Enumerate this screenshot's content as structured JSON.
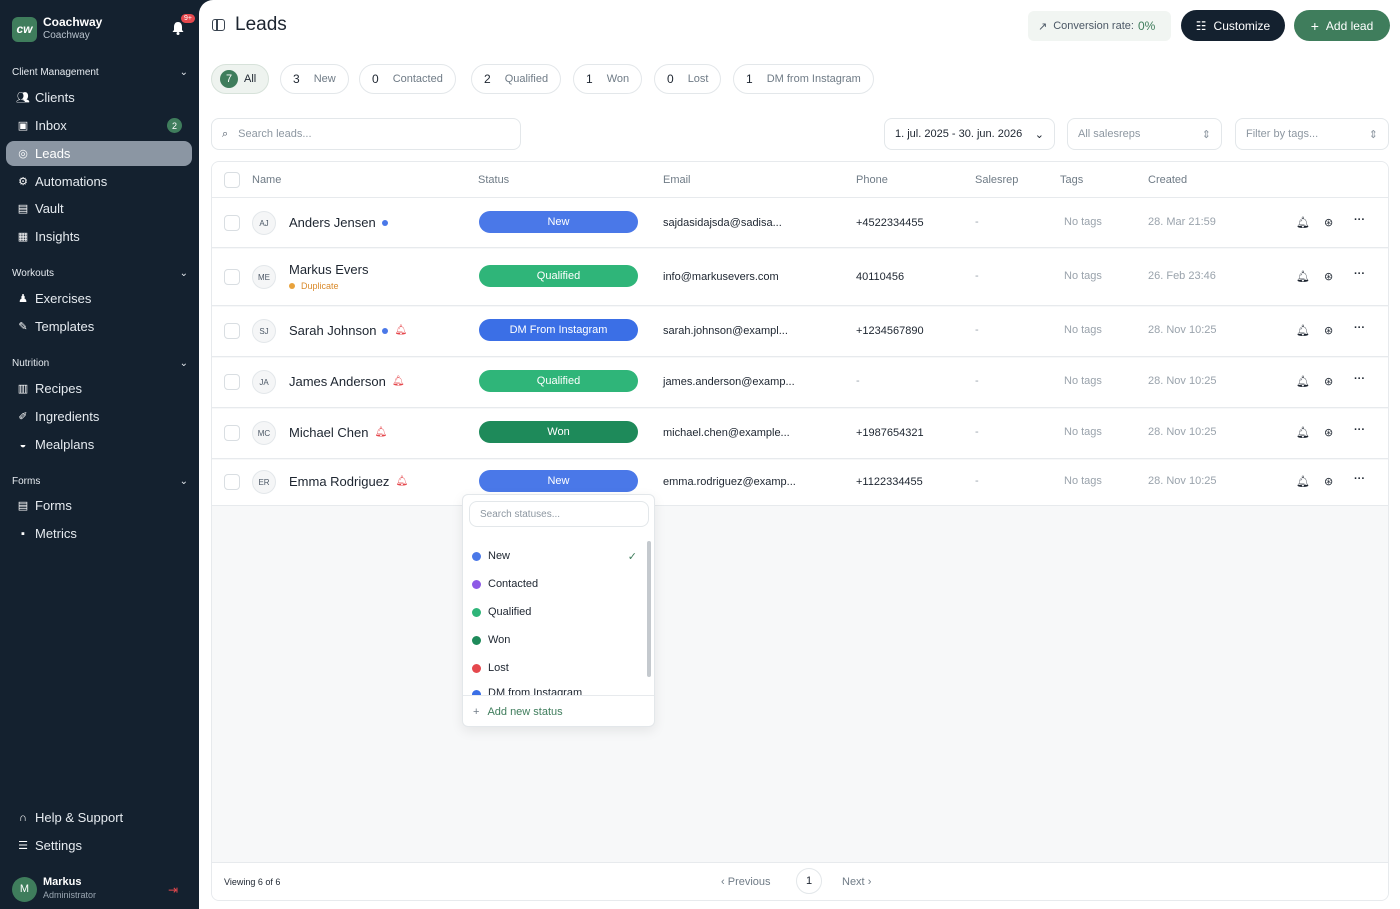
{
  "brand": {
    "name": "Coachway",
    "sub": "Coachway",
    "notif_badge": "9+"
  },
  "sidebar": {
    "sections": [
      {
        "label": "Client Management",
        "items": [
          {
            "label": "Clients",
            "icon": "users-icon"
          },
          {
            "label": "Inbox",
            "icon": "inbox-icon",
            "badge": "2"
          },
          {
            "label": "Leads",
            "icon": "target-icon",
            "active": true
          },
          {
            "label": "Automations",
            "icon": "robot-icon"
          },
          {
            "label": "Vault",
            "icon": "vault-icon"
          },
          {
            "label": "Insights",
            "icon": "chart-icon"
          }
        ]
      },
      {
        "label": "Workouts",
        "items": [
          {
            "label": "Exercises",
            "icon": "exercise-icon"
          },
          {
            "label": "Templates",
            "icon": "template-icon"
          }
        ]
      },
      {
        "label": "Nutrition",
        "items": [
          {
            "label": "Recipes",
            "icon": "recipe-icon"
          },
          {
            "label": "Ingredients",
            "icon": "carrot-icon"
          },
          {
            "label": "Mealplans",
            "icon": "meal-icon"
          }
        ]
      },
      {
        "label": "Forms",
        "items": [
          {
            "label": "Forms",
            "icon": "form-icon"
          },
          {
            "label": "Metrics",
            "icon": "metrics-icon"
          }
        ]
      }
    ],
    "help": "Help & Support",
    "settings": "Settings",
    "user": {
      "initial": "M",
      "name": "Markus",
      "role": "Administrator"
    }
  },
  "header": {
    "title": "Leads",
    "conversion_label": "Conversion rate:",
    "conversion_value": "0%",
    "customize": "Customize",
    "add_lead": "Add lead"
  },
  "tabs": [
    {
      "count": "7",
      "label": "All",
      "active": true
    },
    {
      "count": "3",
      "label": "New"
    },
    {
      "count": "0",
      "label": "Contacted"
    },
    {
      "count": "2",
      "label": "Qualified"
    },
    {
      "count": "1",
      "label": "Won"
    },
    {
      "count": "0",
      "label": "Lost"
    },
    {
      "count": "1",
      "label": "DM from Instagram"
    }
  ],
  "filters": {
    "search_placeholder": "Search leads...",
    "date_range": "1. jul. 2025 - 30. jun. 2026",
    "salesreps": "All salesreps",
    "tags": "Filter by tags..."
  },
  "table": {
    "columns": [
      "Name",
      "Status",
      "Email",
      "Phone",
      "Salesrep",
      "Tags",
      "Created"
    ],
    "rows": [
      {
        "initials": "AJ",
        "name": "Anders Jensen",
        "dot": true,
        "bell": false,
        "status": "New",
        "status_color": "#4a78e8",
        "email": "sajdasidajsda@sadisa...",
        "phone": "+4522334455",
        "salesrep": "-",
        "tags": "No tags",
        "created": "28. Mar 21:59"
      },
      {
        "initials": "ME",
        "name": "Markus Evers",
        "dot": false,
        "bell": false,
        "duplicate": "Duplicate",
        "status": "Qualified",
        "status_color": "#2fb579",
        "email": "info@markusevers.com",
        "phone": "40110456",
        "salesrep": "-",
        "tags": "No tags",
        "created": "26. Feb 23:46"
      },
      {
        "initials": "SJ",
        "name": "Sarah Johnson",
        "dot": true,
        "bell": true,
        "status": "DM From Instagram",
        "status_color": "#3b6fe6",
        "email": "sarah.johnson@exampl...",
        "phone": "+1234567890",
        "salesrep": "-",
        "tags": "No tags",
        "created": "28. Nov 10:25"
      },
      {
        "initials": "JA",
        "name": "James Anderson",
        "dot": false,
        "bell": true,
        "status": "Qualified",
        "status_color": "#2fb579",
        "email": "james.anderson@examp...",
        "phone": "-",
        "salesrep": "-",
        "tags": "No tags",
        "created": "28. Nov 10:25"
      },
      {
        "initials": "MC",
        "name": "Michael Chen",
        "dot": false,
        "bell": true,
        "status": "Won",
        "status_color": "#1e8a5a",
        "email": "michael.chen@example...",
        "phone": "+1987654321",
        "salesrep": "-",
        "tags": "No tags",
        "created": "28. Nov 10:25"
      },
      {
        "initials": "ER",
        "name": "Emma Rodriguez",
        "dot": false,
        "bell": true,
        "status": "New",
        "status_color": "#4a78e8",
        "email": "emma.rodriguez@examp...",
        "phone": "+1122334455",
        "salesrep": "-",
        "tags": "No tags",
        "created": "28. Nov 10:25"
      }
    ]
  },
  "pagination": {
    "viewing": "Viewing 6 of 6",
    "previous": "Previous",
    "page": "1",
    "next": "Next"
  },
  "status_dropdown": {
    "search_placeholder": "Search statuses...",
    "options": [
      {
        "label": "New",
        "color": "#4a78e8",
        "selected": true
      },
      {
        "label": "Contacted",
        "color": "#8e5ae6"
      },
      {
        "label": "Qualified",
        "color": "#2fb579"
      },
      {
        "label": "Won",
        "color": "#1e8a5a"
      },
      {
        "label": "Lost",
        "color": "#e5484d"
      },
      {
        "label": "DM from Instagram",
        "color": "#3b6fe6"
      }
    ],
    "add_new": "Add new status"
  }
}
